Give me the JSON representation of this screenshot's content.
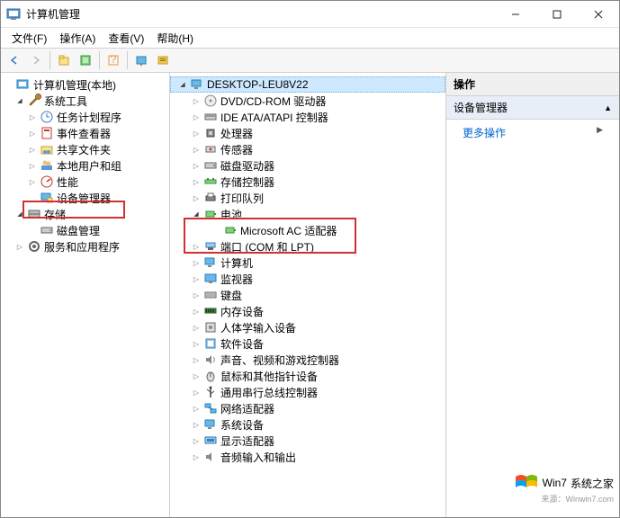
{
  "window": {
    "title": "计算机管理"
  },
  "menubar": {
    "file": "文件(F)",
    "action": "操作(A)",
    "view": "查看(V)",
    "help": "帮助(H)"
  },
  "left_tree": {
    "root": "计算机管理(本地)",
    "systools": "系统工具",
    "tasksched": "任务计划程序",
    "eventvwr": "事件查看器",
    "shared": "共享文件夹",
    "localusers": "本地用户和组",
    "perf": "性能",
    "devmgr": "设备管理器",
    "storage": "存储",
    "diskmgmt": "磁盘管理",
    "services": "服务和应用程序"
  },
  "mid_tree": {
    "computer": "DESKTOP-LEU8V22",
    "dvd": "DVD/CD-ROM 驱动器",
    "ide": "IDE ATA/ATAPI 控制器",
    "cpu": "处理器",
    "sensor": "传感器",
    "disk": "磁盘驱动器",
    "storctrl": "存储控制器",
    "printq": "打印队列",
    "battery": "电池",
    "ac_adapter": "Microsoft AC 适配器",
    "ports": "端口 (COM 和 LPT)",
    "computers": "计算机",
    "monitors": "监视器",
    "keyboard": "键盘",
    "memory": "内存设备",
    "hid": "人体学输入设备",
    "software": "软件设备",
    "sound": "声音、视频和游戏控制器",
    "mouse": "鼠标和其他指针设备",
    "usb": "通用串行总线控制器",
    "network": "网络适配器",
    "system": "系统设备",
    "display": "显示适配器",
    "audio": "音频输入和输出"
  },
  "right_pane": {
    "header": "操作",
    "section": "设备管理器",
    "more": "更多操作"
  },
  "watermark": {
    "brand1": "Win7",
    "brand2": "系统之家",
    "url": "来源：Winwin7.com"
  }
}
